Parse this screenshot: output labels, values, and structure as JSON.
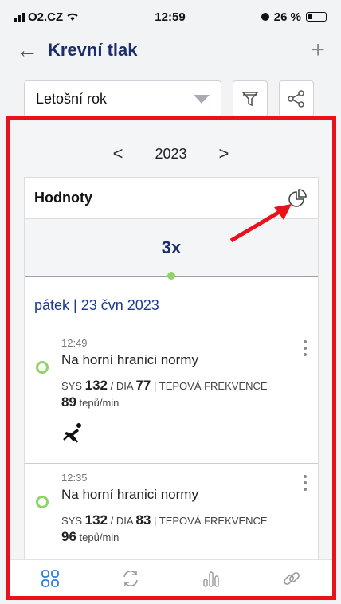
{
  "status_bar": {
    "carrier": "O2.CZ",
    "time": "12:59",
    "battery": "26 %"
  },
  "nav": {
    "title": "Krevní tlak"
  },
  "filter": {
    "period": "Letošní rok"
  },
  "year_nav": {
    "year": "2023"
  },
  "card": {
    "title": "Hodnoty",
    "count": "3x"
  },
  "date_header": "pátek | 23 čvn 2023",
  "entries": [
    {
      "time": "12:49",
      "status": "Na horní hranici normy",
      "sys_label": "SYS",
      "sys": "132",
      "dia_label": "DIA",
      "dia": "77",
      "hr_label": "TEPOVÁ FREKVENCE",
      "hr": "89",
      "hr_unit": "tepů/min"
    },
    {
      "time": "12:35",
      "status": "Na horní hranici normy",
      "sys_label": "SYS",
      "sys": "132",
      "dia_label": "DIA",
      "dia": "83",
      "hr_label": "TEPOVÁ FREKVENCE",
      "hr": "96",
      "hr_unit": "tepů/min"
    }
  ],
  "colors": {
    "accent": "#1b2d6b",
    "status_green": "#8fd467",
    "highlight": "#e8121a",
    "tab_active": "#2b7de9"
  },
  "icons": [
    "back-arrow-icon",
    "plus-icon",
    "filter-icon",
    "share-icon",
    "pie-chart-icon",
    "chevron-left-icon",
    "chevron-right-icon",
    "more-vertical-icon",
    "reclining-position-icon",
    "dashboard-icon",
    "sync-icon",
    "bars-icon",
    "link-icon"
  ]
}
